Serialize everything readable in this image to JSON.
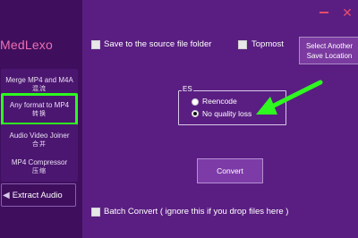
{
  "window": {
    "minimize_label": "—",
    "close_label": "✕"
  },
  "sidebar": {
    "logo": "MedLexo",
    "items": [
      {
        "line1": "Merge MP4 and M4A",
        "line2": "混流"
      },
      {
        "line1": "Any format to MP4",
        "line2": "转换"
      },
      {
        "line1": "Audio Video Joiner",
        "line2": "合并"
      },
      {
        "line1": "MP4 Compressor",
        "line2": "压缩"
      }
    ],
    "extract_label": "Extract Audio"
  },
  "options": {
    "save_to_source_label": "Save to the source file folder",
    "topmost_label": "Topmost",
    "select_another_line1": "Select Another",
    "select_another_line2": "Save Location"
  },
  "es_group": {
    "legend": "ES",
    "reencode_label": "Reencode",
    "no_quality_loss_label": "No quality loss",
    "selected": "No quality loss"
  },
  "convert_label": "Convert",
  "batch_convert_label": "Batch Convert   ( ignore this if you drop files here )",
  "colors": {
    "background": "#5a1e82",
    "sidebar": "#3f0f5e",
    "logo": "#ee6fb0",
    "highlight": "#2ef81f",
    "window_controls": "#e64c6a"
  }
}
